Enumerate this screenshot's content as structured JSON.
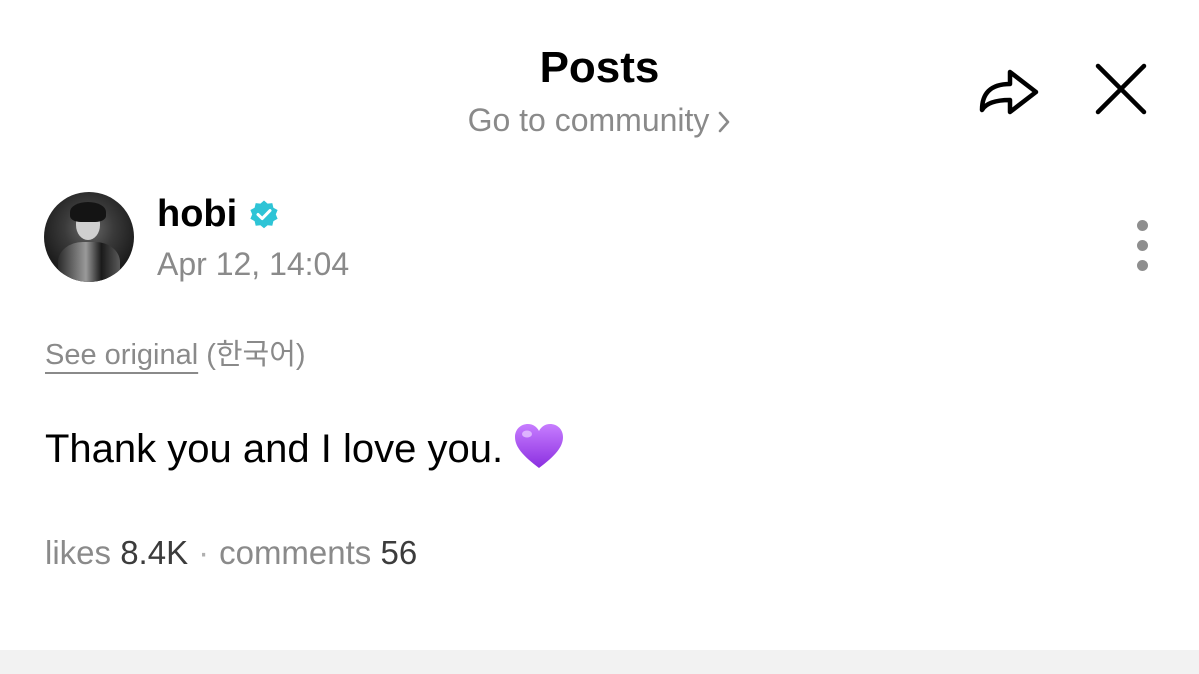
{
  "header": {
    "title": "Posts",
    "community_link": "Go to community",
    "icons": {
      "share": "share-icon",
      "close": "close-icon",
      "chevron": "chevron-right-icon"
    }
  },
  "post": {
    "author": {
      "name": "hobi",
      "verified": true,
      "verified_color": "#2ec4d6",
      "avatar": "avatar"
    },
    "timestamp": "Apr 12, 14:04",
    "translation": {
      "link_label": "See original",
      "language_note": "(한국어)"
    },
    "text": "Thank you and I love you.",
    "emoji": "purple-heart",
    "emoji_color": "#a855f7",
    "stats": {
      "likes_label": "likes",
      "likes_value": "8.4K",
      "separator": "·",
      "comments_label": "comments",
      "comments_value": "56"
    }
  },
  "colors": {
    "secondary_text": "#8a8a8a",
    "primary_text": "#000000",
    "background": "#ffffff",
    "bottom_bar": "#f2f2f2"
  }
}
